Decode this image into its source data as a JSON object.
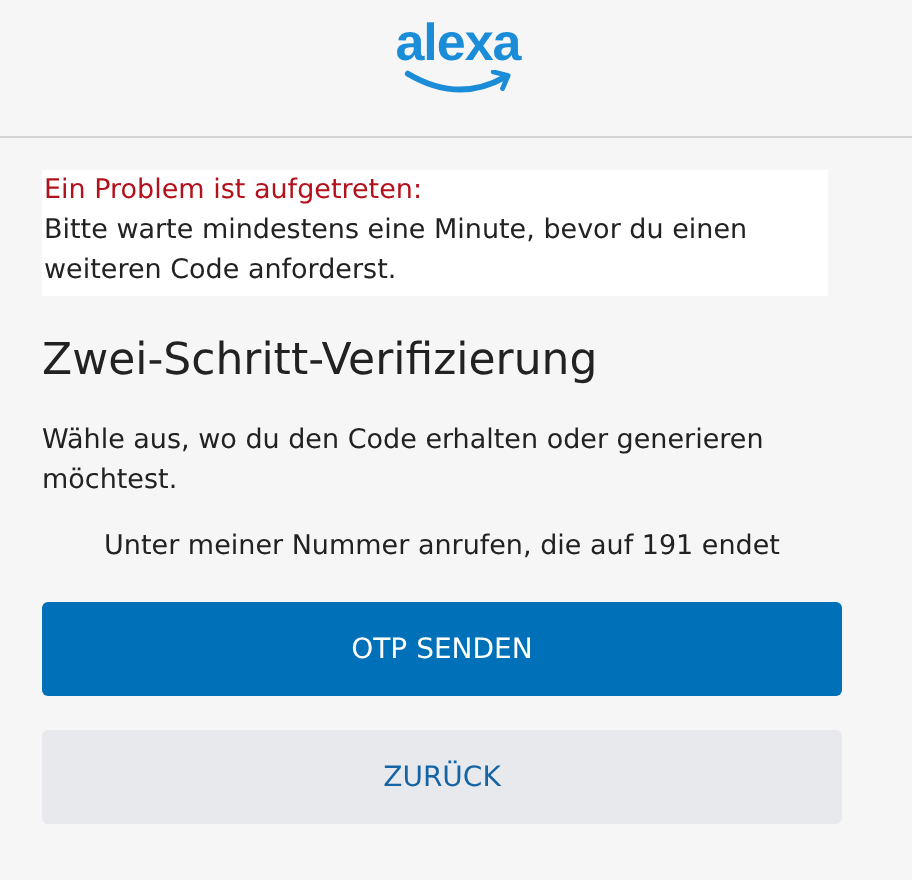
{
  "header": {
    "logo": "alexa"
  },
  "alert": {
    "title": "Ein Problem ist aufgetreten:",
    "message": "Bitte warte mindestens eine Minute, bevor du einen weiteren Code anforderst."
  },
  "heading": "Zwei-Schritt-Verifizierung",
  "instruction": "Wähle aus, wo du den Code erhalten oder generieren möchtest.",
  "option": "Unter meiner Nummer anrufen, die auf 191 endet",
  "buttons": [
    {
      "label": "OTP SENDEN",
      "kind": "primary"
    },
    {
      "label": "ZURÜCK",
      "kind": "secondary"
    }
  ]
}
